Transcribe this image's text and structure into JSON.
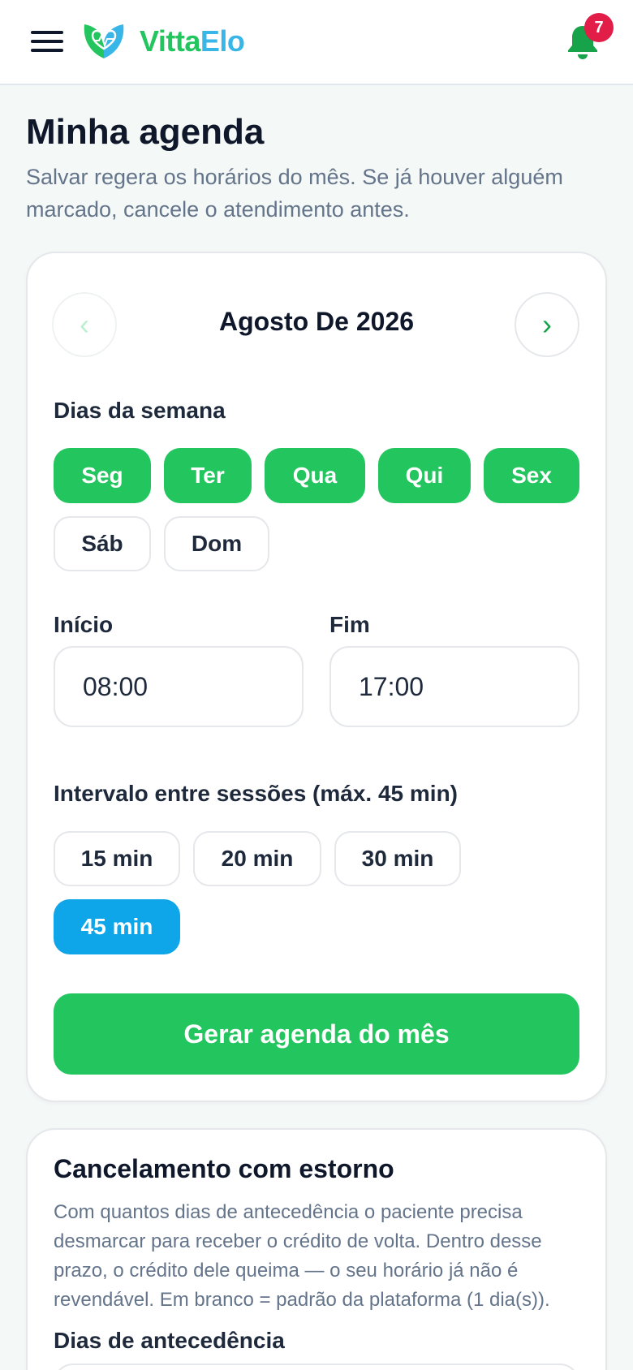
{
  "header": {
    "brand_part1": "Vitta",
    "brand_part2": "Elo",
    "notification_count": "7"
  },
  "page": {
    "title": "Minha agenda",
    "subtitle": "Salvar regera os horários do mês. Se já houver alguém marcado, cancele o atendimento antes."
  },
  "schedule": {
    "month_label": "Agosto De 2026",
    "prev_icon": "‹",
    "next_icon": "›",
    "weekdays_label": "Dias da semana",
    "weekdays": [
      {
        "label": "Seg",
        "selected": true
      },
      {
        "label": "Ter",
        "selected": true
      },
      {
        "label": "Qua",
        "selected": true
      },
      {
        "label": "Qui",
        "selected": true
      },
      {
        "label": "Sex",
        "selected": true
      },
      {
        "label": "Sáb",
        "selected": false
      },
      {
        "label": "Dom",
        "selected": false
      }
    ],
    "start_label": "Início",
    "start_value": "08:00",
    "end_label": "Fim",
    "end_value": "17:00",
    "interval_label": "Intervalo entre sessões (máx. 45 min)",
    "intervals": [
      {
        "label": "15 min",
        "selected": false
      },
      {
        "label": "20 min",
        "selected": false
      },
      {
        "label": "30 min",
        "selected": false
      },
      {
        "label": "45 min",
        "selected": true
      }
    ],
    "generate_button": "Gerar agenda do mês"
  },
  "cancellation": {
    "title": "Cancelamento com estorno",
    "description": "Com quantos dias de antecedência o paciente precisa desmarcar para receber o crédito de volta. Dentro desse prazo, o crédito dele queima — o seu horário já não é revendável. Em branco = padrão da plataforma (1 dia(s)).",
    "days_label": "Dias de antecedência"
  },
  "colors": {
    "brand_green": "#22c55e",
    "brand_blue": "#38b6e8",
    "selected_interval": "#0ea5e9",
    "badge": "#e11d48"
  },
  "icons": {
    "menu": "hamburger-menu-icon",
    "logo": "leaf-heart-logo-icon",
    "notifications": "bell-icon"
  }
}
